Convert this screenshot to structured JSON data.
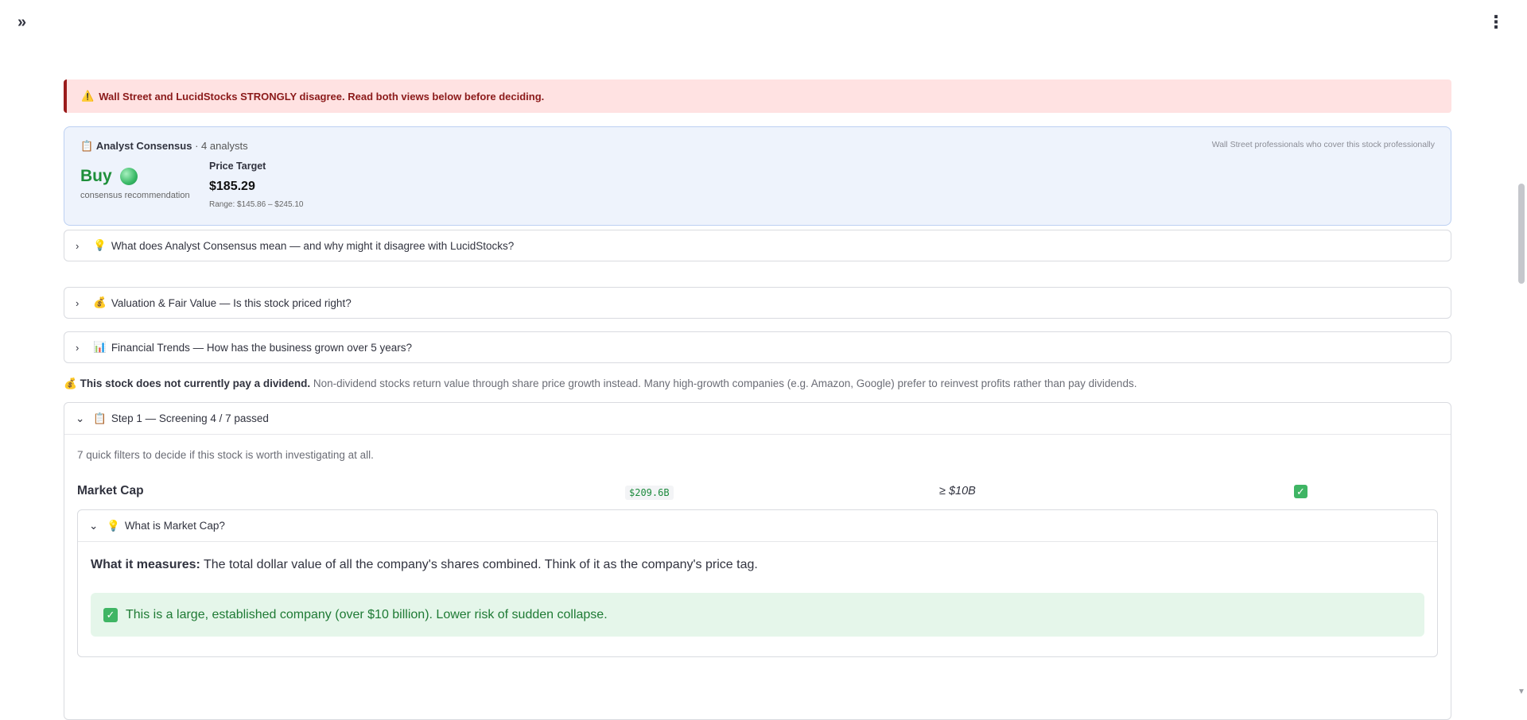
{
  "topbar": {
    "sidebar_toggle_glyph": "»",
    "menu_glyph": "⋮"
  },
  "warning": {
    "emoji": "⚠️",
    "text": "Wall Street and LucidStocks STRONGLY disagree. Read both views below before deciding."
  },
  "consensus": {
    "emoji": "📋",
    "title": "Analyst Consensus",
    "analyst_count": "· 4 analysts",
    "note": "Wall Street professionals who cover this stock professionally",
    "recommendation": "Buy",
    "recommendation_sub": "consensus recommendation",
    "price_target_label": "Price Target",
    "price_target_value": "$185.29",
    "range": "Range: $145.86 – $245.10",
    "status_color": "#38b865"
  },
  "expanders": [
    {
      "emoji": "💡",
      "label": "What does Analyst Consensus mean — and why might it disagree with LucidStocks?"
    },
    {
      "emoji": "💰",
      "label": "Valuation & Fair Value — Is this stock priced right?"
    },
    {
      "emoji": "📊",
      "label": "Financial Trends — How has the business grown over 5 years?"
    }
  ],
  "dividend": {
    "emoji": "💰",
    "bold": "This stock does not currently pay a dividend.",
    "text": " Non-dividend stocks return value through share price growth instead. Many high-growth companies (e.g. Amazon, Google) prefer to reinvest profits rather than pay dividends."
  },
  "step1": {
    "emoji": "📋",
    "label": "Step 1 — Screening 4 / 7 passed",
    "description": "7 quick filters to decide if this stock is worth investigating at all.",
    "metric": {
      "name": "Market Cap",
      "value": "$209.6B",
      "threshold": "≥ $10B",
      "passed": "✓"
    },
    "explainer": {
      "emoji": "💡",
      "label": "What is Market Cap?",
      "measures_label": "What it measures:",
      "measures_text": " The total dollar value of all the company's shares combined. Think of it as the company's price tag.",
      "verdict_icon": "✓",
      "verdict": "This is a large, established company (over $10 billion). Lower risk of sudden collapse."
    }
  },
  "icons": {
    "chevron_right": "›",
    "chevron_down": "⌄",
    "scroll_down": "▼"
  }
}
